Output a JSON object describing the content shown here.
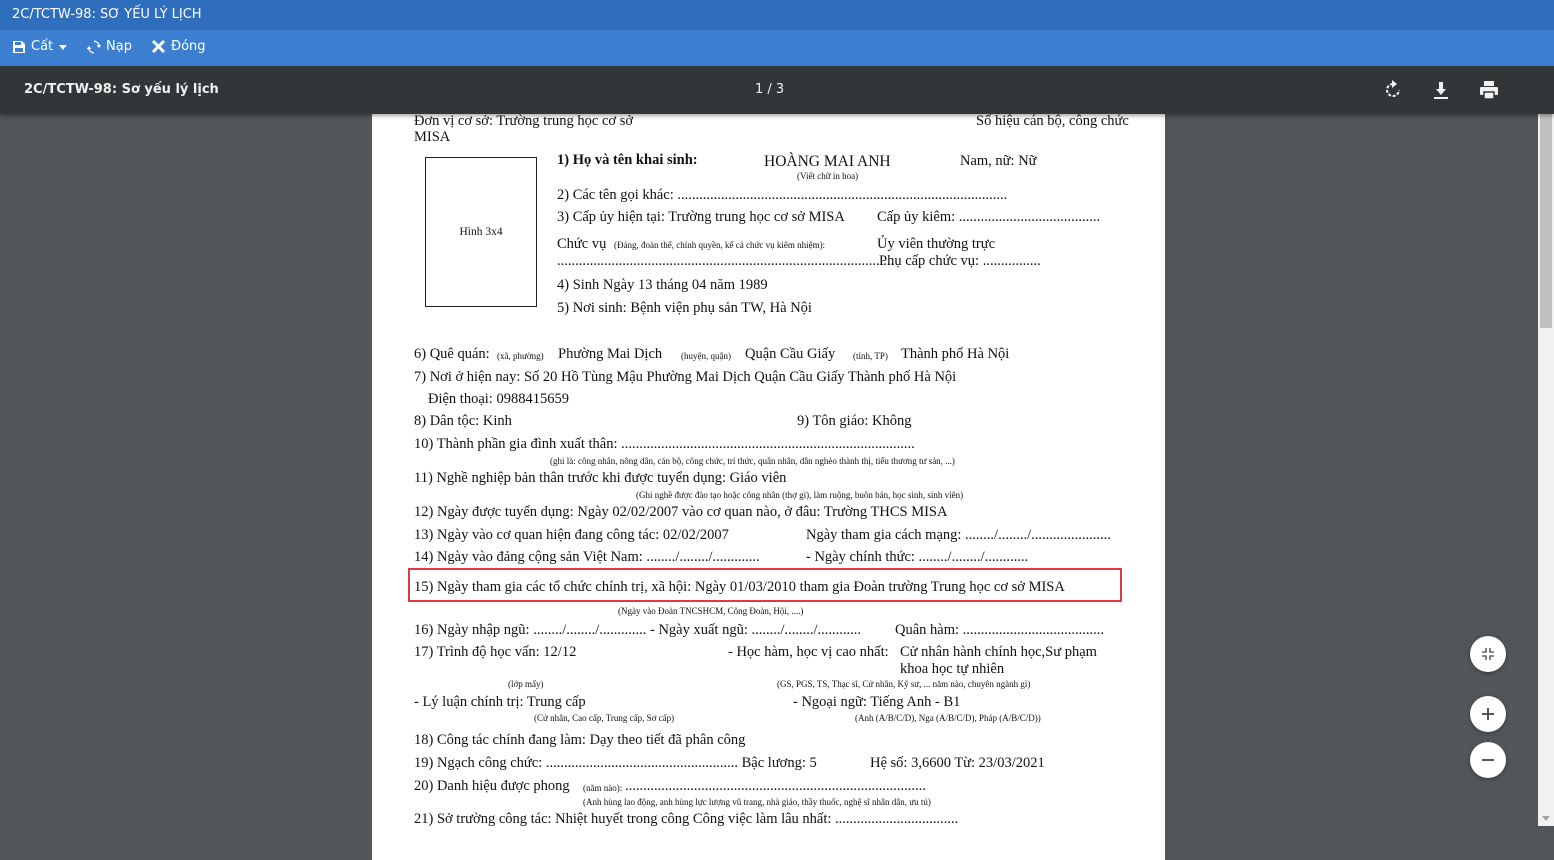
{
  "window": {
    "title": "2C/TCTW-98: SƠ YẾU LÝ LỊCH"
  },
  "toolbar": {
    "save_label": "Cất",
    "reload_label": "Nạp",
    "close_label": "Đóng"
  },
  "viewer": {
    "doc_title": "2C/TCTW-98: Sơ yếu lý lịch",
    "page_indicator": "1 / 3"
  },
  "doc": {
    "unit_line1": "Đơn vị cơ sở: Trường trung học cơ sở",
    "unit_line2": "MISA",
    "staff_code": "Số hiệu cán bộ, công chức",
    "photo": "Hình 3x4",
    "f1_label": "1) Họ và tên khai sinh:",
    "f1_value": "HOÀNG MAI ANH",
    "f1_gender": "Nam, nữ: Nữ",
    "f1_note": "(Viết chữ in hoa)",
    "f2": "2) Các tên gọi khác: ...........................................................................................",
    "f3a": "3) Cấp ủy hiện tại: Trường trung học cơ sở MISA",
    "f3b": "Cấp ủy kiêm: .......................................",
    "f3c_label": "Chức vụ",
    "f3c_note": "(Đảng, đoàn thể, chính quyền, kể cả chức vụ kiêm nhiệm):",
    "f3c_value": "Ủy viên thường trực",
    "f3d": ".............................................................................................",
    "f3e": "Phụ cấp chức vụ: ................",
    "f4": "4) Sinh Ngày 13 tháng 04 năm 1989",
    "f5": "5) Nơi sinh: Bệnh viện phụ sản TW, Hà Nội",
    "f6_label": "6) Quê quán:",
    "f6_n1": "(xã, phường)",
    "f6_v1": "Phường Mai Dịch",
    "f6_n2": "(huyện, quận)",
    "f6_v2": "Quận Cầu Giấy",
    "f6_n3": "(tỉnh, TP)",
    "f6_v3": "Thành phố Hà Nội",
    "f7": "7) Nơi ở hiện nay: Số 20 Hồ Tùng Mậu Phường Mai Dịch Quận Cầu Giấy Thành phố Hà Nội",
    "f7_phone": "Điện thoại: 0988415659",
    "f8": "8) Dân tộc:  Kinh",
    "f9": "9) Tôn giáo:   Không",
    "f10": "10) Thành phần gia đình xuất thân: .................................................................................",
    "f10_note": "(ghi là: công nhân, nông dân, cán bộ, công chức, trí thức, quân nhân, dân nghèo thành thị, tiểu thương tư sản, ...)",
    "f11": "11) Nghề nghiệp bản thân trước khi được tuyển dụng: Giáo viên",
    "f11_note": "(Ghi nghề được đào tạo hoặc công nhân (thợ gì), làm ruộng, buôn bán, học sinh, sinh viên)",
    "f12": "12) Ngày được tuyển dụng: Ngày 02/02/2007 vào cơ quan nào, ở đâu: Trường THCS MISA",
    "f13": "13) Ngày vào cơ quan hiện đang công tác: 02/02/2007",
    "f13b": "Ngày tham gia cách mạng: ......../......../......................",
    "f14": "14) Ngày vào đảng cộng sản Việt Nam: ......../......../.............",
    "f14b": "- Ngày chính thức: ......../......../............",
    "f15": "15) Ngày tham gia các tổ chức chính trị, xã hội: Ngày 01/03/2010 tham gia Đoàn trường Trung học cơ sở MISA",
    "f15_note": "(Ngày vào Đoàn TNCSHCM, Công Đoàn, Hội, ....)",
    "f16": "16) Ngày nhập ngũ: ......../......../............. - Ngày xuất ngũ: ......../......../............",
    "f16b": "Quân hàm: .......................................",
    "f17": "17) Trình độ học vấn:  12/12",
    "f17_note": "(lớp mấy)",
    "f17b": "- Học hàm, học vị cao nhất:",
    "f17b_v1": "Cử nhân hành chính học,Sư phạm",
    "f17b_v2": "khoa học tự nhiên",
    "f17b_note": "(GS, PGS, TS, Thạc sĩ, Cử nhân, Kỹ sư, ... năm nào, chuyên ngành gì)",
    "f17c": "- Lý luận chính trị: Trung cấp",
    "f17c_note": "(Cử nhân, Cao cấp, Trung cấp, Sơ cấp)",
    "f17d": "- Ngoại ngữ: Tiếng Anh - B1",
    "f17d_note": "(Anh (A/B/C/D),    Nga (A/B/C/D),    Pháp (A/B/C/D))",
    "f18": "18) Công tác chính đang làm: Dạy theo tiết đã phân công",
    "f19": "19) Ngạch công chức: ..................................................... Bậc lương: 5",
    "f19b": "Hệ số: 3,6600   Từ: 23/03/2021",
    "f20_label": "20) Danh hiệu được phong",
    "f20_note": "(năm nào):",
    "f20_dots": "...................................................................................",
    "f20_note2": "(Anh hùng lao động, anh hùng lực lượng vũ trang, nhà giáo, thầy thuốc, nghệ sĩ nhân dân, ưu tú)",
    "f21": "21) Sở trường công tác: Nhiệt huyết trong công Công việc làm lâu nhất: .................................."
  }
}
